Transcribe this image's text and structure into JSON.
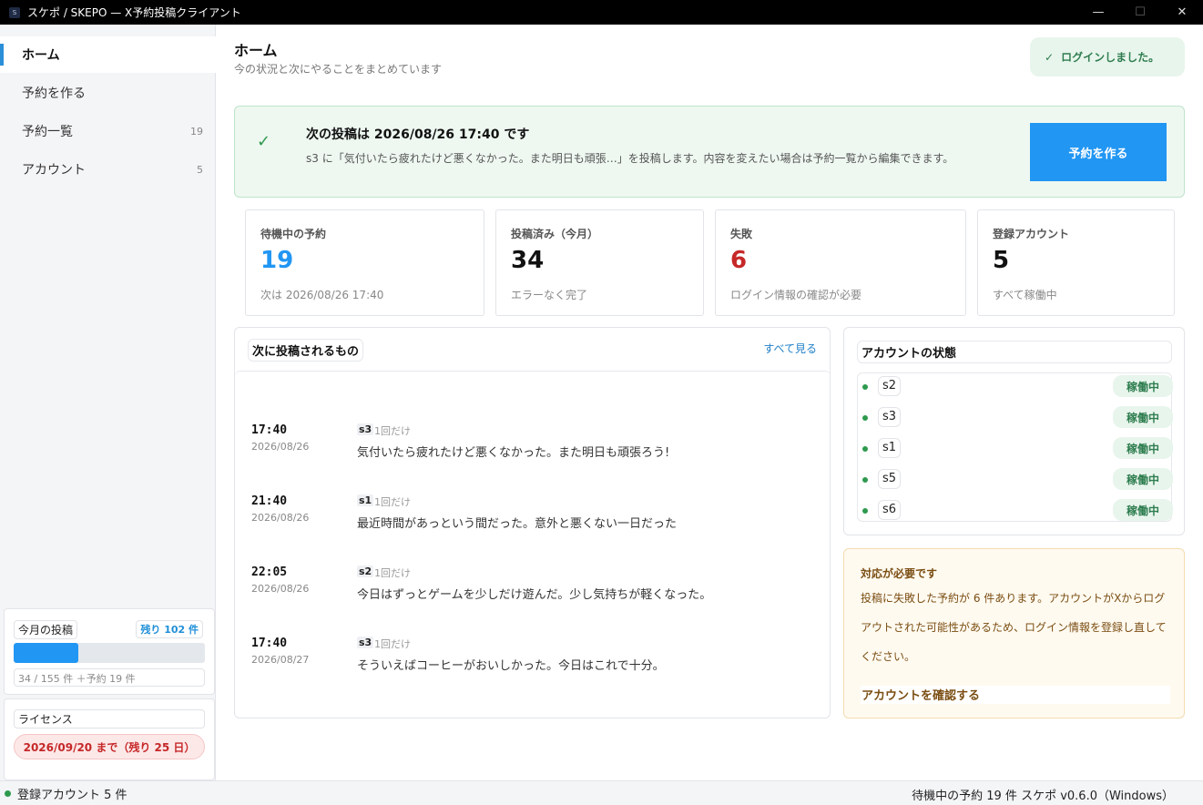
{
  "window": {
    "title": "スケポ / SKEPO — X予約投稿クライアント",
    "controls": {
      "minimize": "—",
      "maximize": "☐",
      "close": "✕"
    }
  },
  "sidebar": {
    "items": [
      {
        "label": "ホーム",
        "count": "",
        "active": true
      },
      {
        "label": "予約を作る",
        "count": ""
      },
      {
        "label": "予約一覧",
        "count": "19"
      },
      {
        "label": "アカウント",
        "count": "5"
      }
    ],
    "monthly": {
      "label": "今月の投稿",
      "remaining": "残り 102 件",
      "progress_fraction": 0.34,
      "text": "34 / 155 件 ＋予約 19 件"
    },
    "license": {
      "label": "ライセンス",
      "expiry": "2026/09/20 まで（残り 25 日）"
    }
  },
  "header": {
    "title": "ホーム",
    "subtitle": "今の状況と次にやることをまとめています",
    "toast": "ログインしました。",
    "toast_icon": "check-icon"
  },
  "banner": {
    "title": "次の投稿は 2026/08/26 17:40 です",
    "text": "s3 に「気付いたら疲れたけど悪くなかった。また明日も頑張…」を投稿します。内容を変えたい場合は予約一覧から編集できます。",
    "button": "予約を作る"
  },
  "stats": [
    {
      "label": "待機中の予約",
      "value": "19",
      "sub": "次は 2026/08/26 17:40",
      "color": "#2196f3"
    },
    {
      "label": "投稿済み（今月）",
      "value": "34",
      "sub": "エラーなく完了",
      "color": "#111111"
    },
    {
      "label": "失敗",
      "value": "6",
      "sub": "ログイン情報の確認が必要",
      "color": "#c62828"
    },
    {
      "label": "登録アカウント",
      "value": "5",
      "sub": "すべて稼働中",
      "color": "#111111"
    }
  ],
  "upcoming": {
    "title": "次に投稿されるもの",
    "see_all": "すべて見る",
    "items": [
      {
        "time": "17:40",
        "date": "2026/08/26",
        "account": "s3",
        "freq": "1回だけ",
        "text": "気付いたら疲れたけど悪くなかった。また明日も頑張ろう!"
      },
      {
        "time": "21:40",
        "date": "2026/08/26",
        "account": "s1",
        "freq": "1回だけ",
        "text": "最近時間があっという間だった。意外と悪くない一日だった"
      },
      {
        "time": "22:05",
        "date": "2026/08/26",
        "account": "s2",
        "freq": "1回だけ",
        "text": "今日はずっとゲームを少しだけ遊んだ。少し気持ちが軽くなった。"
      },
      {
        "time": "17:40",
        "date": "2026/08/27",
        "account": "s3",
        "freq": "1回だけ",
        "text": "そういえばコーヒーがおいしかった。今日はこれで十分。"
      }
    ]
  },
  "accounts": {
    "title": "アカウントの状態",
    "items": [
      {
        "name": "s2",
        "status": "稼働中"
      },
      {
        "name": "s3",
        "status": "稼働中"
      },
      {
        "name": "s1",
        "status": "稼働中"
      },
      {
        "name": "s5",
        "status": "稼働中"
      },
      {
        "name": "s6",
        "status": "稼働中"
      }
    ]
  },
  "warning": {
    "title": "対応が必要です",
    "text": "投稿に失敗した予約が 6 件あります。アカウントがXからログアウトされた可能性があるため、ログイン情報を登録し直してください。",
    "link": "アカウントを確認する"
  },
  "statusbar": {
    "left": "登録アカウント 5 件",
    "right": "待機中の予約 19 件 スケポ v0.6.0（Windows）"
  }
}
